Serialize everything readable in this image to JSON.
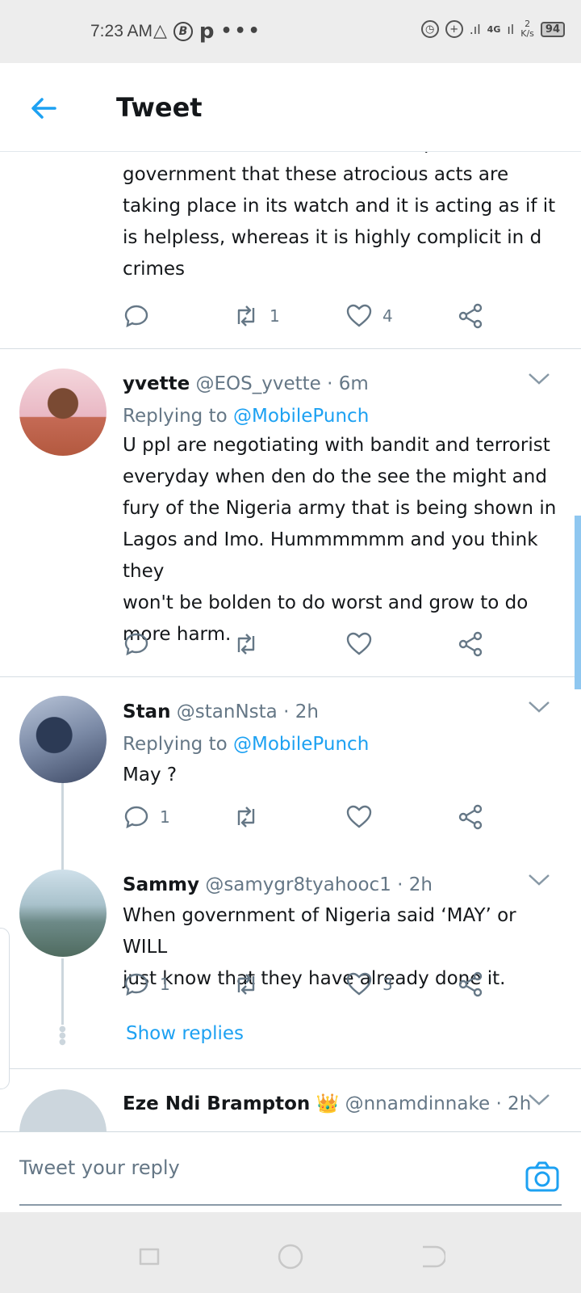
{
  "status_bar": {
    "time": "7:23 AM",
    "left_icons": [
      "warning-triangle-icon",
      "b-circle-icon",
      "p-icon",
      "more-dots-icon"
    ],
    "network": "4G",
    "speed_value": "2",
    "speed_unit": "K/s",
    "battery": "94"
  },
  "header": {
    "title": "Tweet"
  },
  "tweets": [
    {
      "text_lines": [
        "terrorists not bandits.., it is a slap on this",
        "government that these atrocious acts are",
        "taking place in its watch and it is acting as if it",
        "is helpless, whereas it is highly complicit in d",
        "crimes"
      ],
      "replies": "",
      "retweets": "1",
      "likes": "4"
    },
    {
      "name": "yvette",
      "handle": "@EOS_yvette",
      "time": "· 6m",
      "replying_prefix": "Replying to",
      "replying_to": "@MobilePunch",
      "text_lines": [
        "U ppl are negotiating with bandit and terrorist",
        "everyday when den do the see the might and",
        "fury of the Nigeria army that is being shown in",
        "Lagos and Imo. Hummmmmm and you think they",
        "won't be bolden to do worst and grow to do",
        "more harm."
      ],
      "replies": "",
      "retweets": "",
      "likes": ""
    },
    {
      "name": "Stan",
      "handle": "@stanNsta",
      "time": "· 2h",
      "replying_prefix": "Replying to",
      "replying_to": "@MobilePunch",
      "text_lines": [
        "May ?"
      ],
      "replies": "1",
      "retweets": "",
      "likes": ""
    },
    {
      "name": "Sammy",
      "handle": "@samygr8tyahooc1",
      "time": "· 2h",
      "text_lines": [
        "When government of Nigeria said ‘MAY’ or WILL",
        "just know that they have already done it."
      ],
      "replies": "1",
      "retweets": "",
      "likes": "3"
    },
    {
      "name": "Eze Ndi Brampton",
      "emoji": "👑",
      "handle": "@nnamdinnake",
      "time": "· 2h"
    }
  ],
  "show_replies": "Show replies",
  "reply_bar": {
    "placeholder": "Tweet your reply"
  },
  "colors": {
    "accent": "#1da1f2",
    "text": "#14171a",
    "secondary": "#657786"
  }
}
